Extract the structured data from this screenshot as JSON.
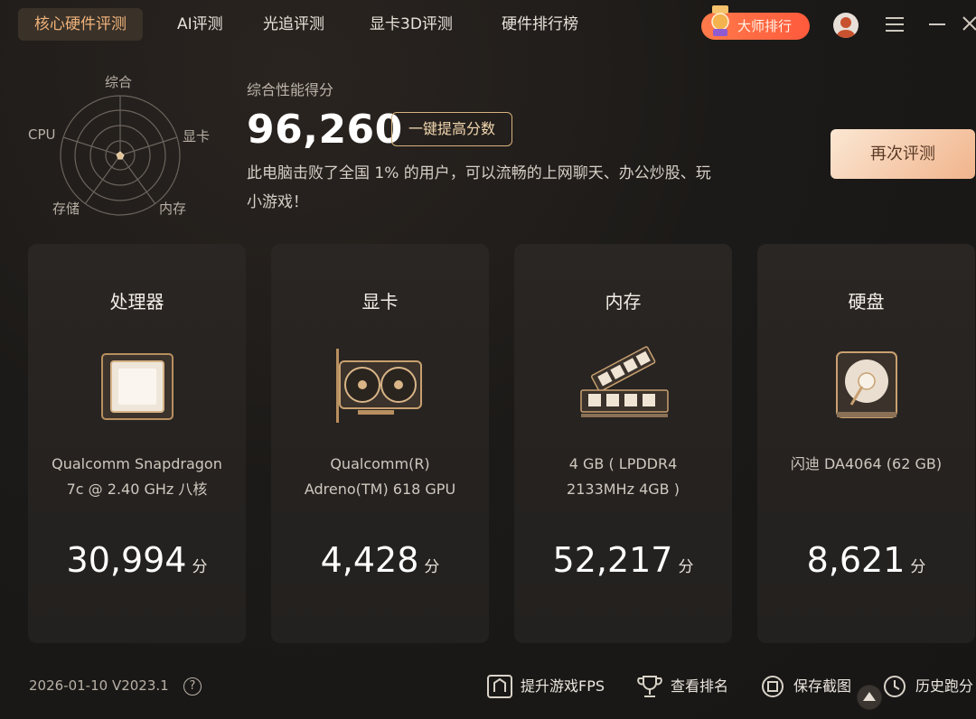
{
  "nav": {
    "tabs": [
      {
        "label": "核心硬件评测",
        "active": true
      },
      {
        "label": "AI评测"
      },
      {
        "label": "光追评测"
      },
      {
        "label": "显卡3D评测"
      },
      {
        "label": "硬件排行榜"
      }
    ],
    "master_rank_label": "大师排行"
  },
  "radar": {
    "labels": {
      "top": "综合",
      "right": "显卡",
      "bottom_right": "内存",
      "bottom_left": "存储",
      "left": "CPU"
    }
  },
  "summary": {
    "title": "综合性能得分",
    "score": "96,260",
    "boost_label": "一键提高分数",
    "description_line1": "此电脑击败了全国 1% 的用户，可以流畅的上网聊天、办公炒股、玩",
    "description_line2": "小游戏！",
    "retest_label": "再次评测"
  },
  "cards": [
    {
      "title": "处理器",
      "icon": "cpu-icon",
      "desc1": "Qualcomm Snapdragon",
      "desc2": "7c @ 2.40 GHz 八核",
      "score": "30,994",
      "unit": "分"
    },
    {
      "title": "显卡",
      "icon": "gpu-icon",
      "desc1": "Qualcomm(R)",
      "desc2": "Adreno(TM) 618 GPU",
      "score": "4,428",
      "unit": "分"
    },
    {
      "title": "内存",
      "icon": "ram-icon",
      "desc1": "4 GB ( LPDDR4",
      "desc2": "2133MHz 4GB )",
      "score": "52,217",
      "unit": "分"
    },
    {
      "title": "硬盘",
      "icon": "disk-icon",
      "desc1": "闪迪 DA4064 (62 GB)",
      "desc2": "",
      "score": "8,621",
      "unit": "分"
    }
  ],
  "footer": {
    "version": "2026-01-10 V2023.1",
    "help": "?",
    "actions": [
      {
        "label": "提升游戏FPS",
        "icon": "fps-icon"
      },
      {
        "label": "查看排名",
        "icon": "trophy-icon"
      },
      {
        "label": "保存截图",
        "icon": "screenshot-icon"
      },
      {
        "label": "历史跑分",
        "icon": "history-icon"
      }
    ]
  },
  "colors": {
    "accent": "#f0b27a",
    "master": "#ff6a42",
    "retest": "#f1b48c"
  }
}
